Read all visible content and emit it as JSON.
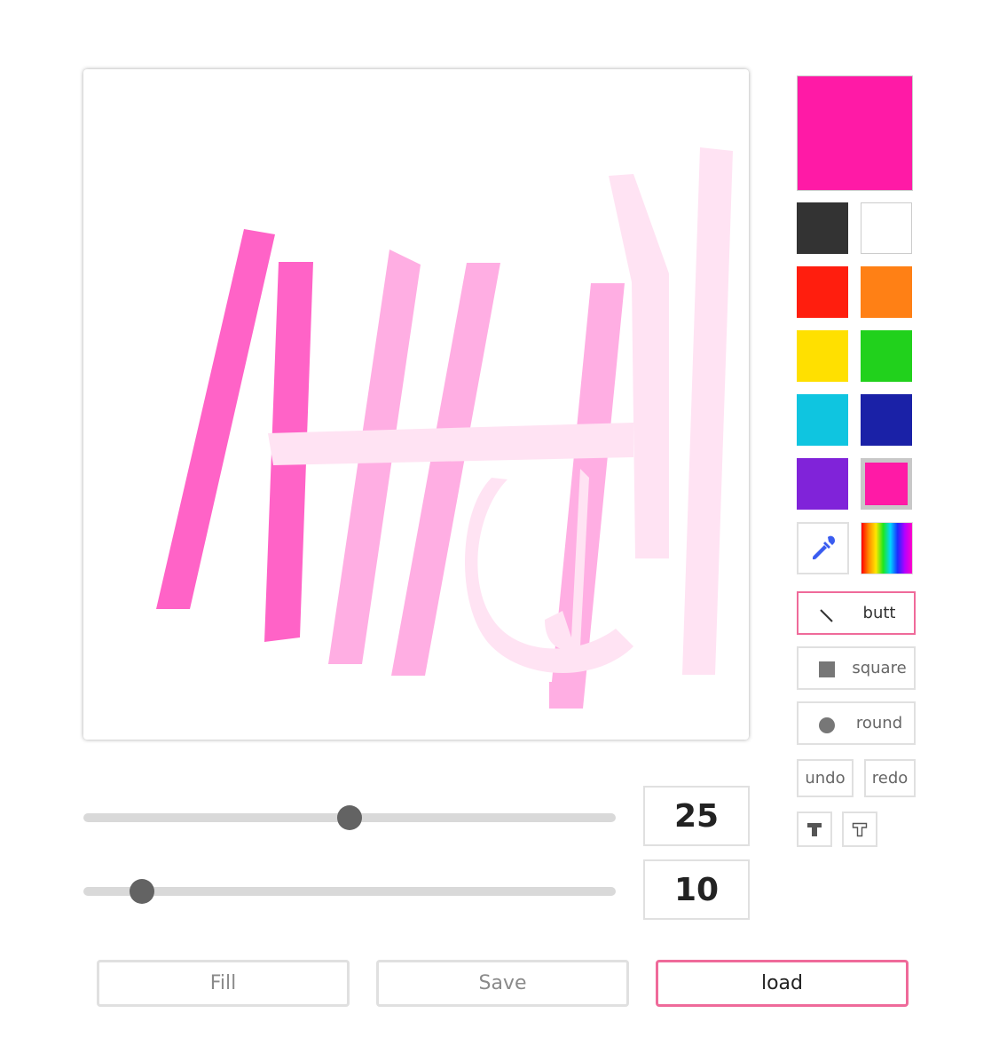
{
  "palette": {
    "current_color": "#ff1aa6",
    "swatches": [
      "#333333",
      "#ffffff",
      "#ff1e0e",
      "#ff8015",
      "#ffe000",
      "#21d11c",
      "#0fc5e0",
      "#1a21a7",
      "#8023d9",
      "#ff1aa6"
    ],
    "eyedropper_icon": "eyedropper-icon",
    "rainbow_icon": "color-spectrum-icon"
  },
  "line_caps": {
    "butt_label": "butt",
    "square_label": "square",
    "round_label": "round",
    "active": "butt"
  },
  "history": {
    "undo_label": "undo",
    "redo_label": "redo"
  },
  "text_tools": {
    "bold_icon": "text-bold-icon",
    "outline_icon": "text-outline-icon"
  },
  "sliders": {
    "size_value": "25",
    "size_fraction": 0.5,
    "opacity_value": "10",
    "opacity_fraction": 0.11
  },
  "actions": {
    "fill_label": "Fill",
    "save_label": "Save",
    "load_label": "load"
  }
}
